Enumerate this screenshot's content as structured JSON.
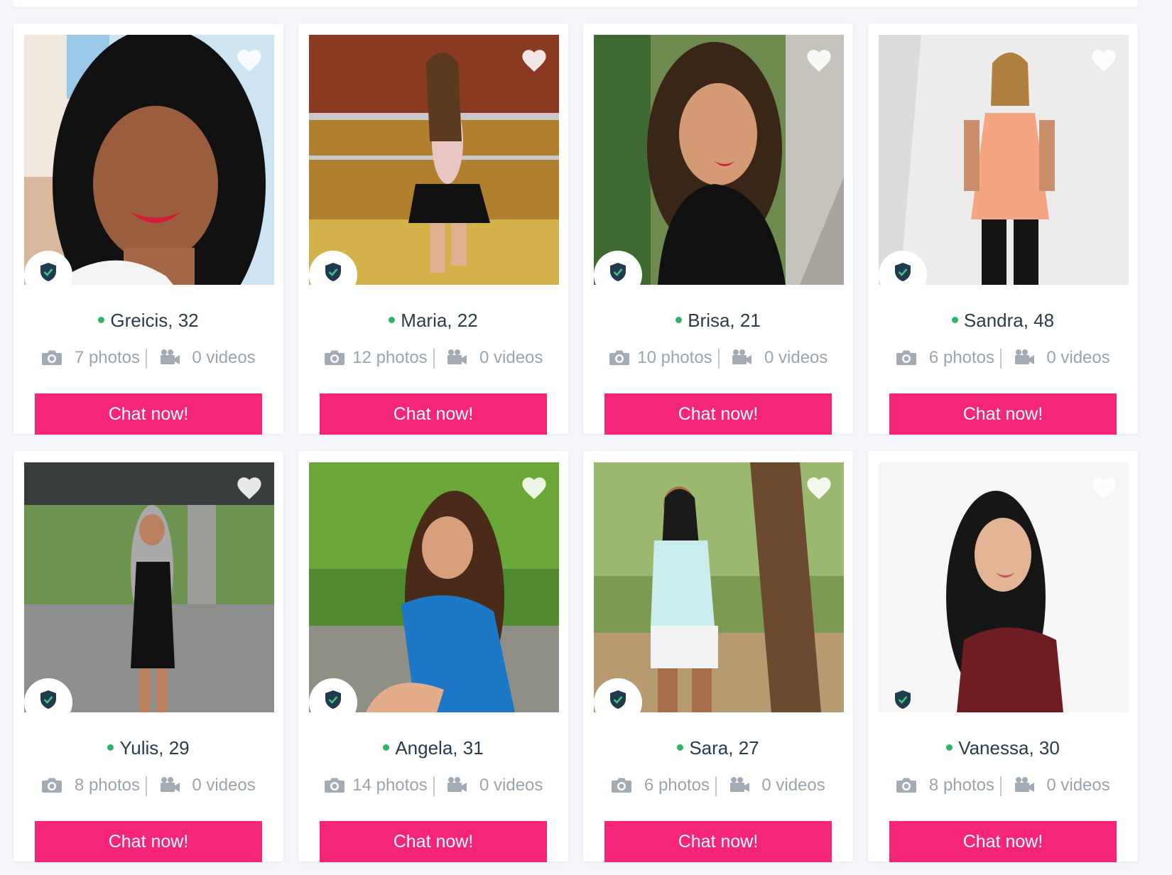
{
  "colors": {
    "accent": "#f5257a",
    "online": "#2bb56a",
    "name_text": "#2a3b4a",
    "muted_text": "#9aa4ae",
    "page_bg": "#f4f6fb"
  },
  "icons": {
    "favorite": "heart-icon",
    "verified": "shield-check-icon",
    "photos": "camera-icon",
    "videos": "video-camera-icon"
  },
  "profiles": [
    {
      "name": "Greicis, 32",
      "photos": "7 photos",
      "videos": "0 videos",
      "cta": "Chat now!",
      "online": true
    },
    {
      "name": "Maria, 22",
      "photos": "12 photos",
      "videos": "0 videos",
      "cta": "Chat now!",
      "online": true
    },
    {
      "name": "Brisa, 21",
      "photos": "10 photos",
      "videos": "0 videos",
      "cta": "Chat now!",
      "online": true
    },
    {
      "name": "Sandra, 48",
      "photos": "6 photos",
      "videos": "0 videos",
      "cta": "Chat now!",
      "online": true
    },
    {
      "name": "Yulis, 29",
      "photos": "8 photos",
      "videos": "0 videos",
      "cta": "Chat now!",
      "online": true
    },
    {
      "name": "Angela, 31",
      "photos": "14 photos",
      "videos": "0 videos",
      "cta": "Chat now!",
      "online": true
    },
    {
      "name": "Sara, 27",
      "photos": "6 photos",
      "videos": "0 videos",
      "cta": "Chat now!",
      "online": true
    },
    {
      "name": "Vanessa, 30",
      "photos": "8 photos",
      "videos": "0 videos",
      "cta": "Chat now!",
      "online": true
    }
  ]
}
